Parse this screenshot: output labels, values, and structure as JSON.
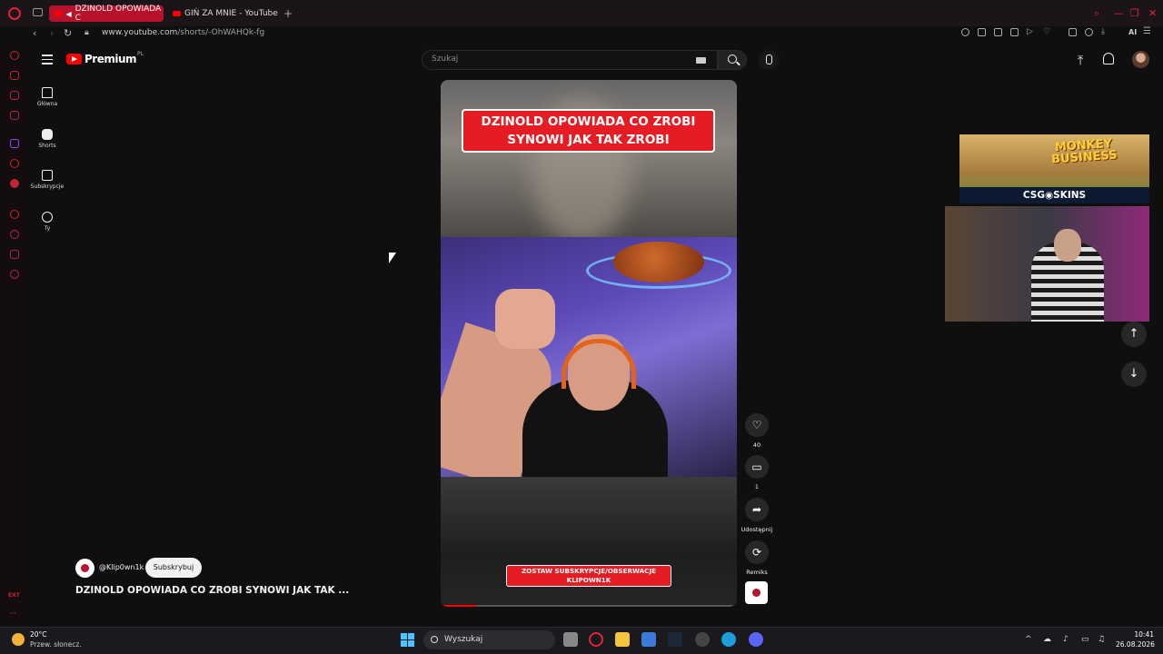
{
  "browser": {
    "tabs": [
      {
        "label": "DZINOLD OPOWIADA C",
        "active": true
      },
      {
        "label": "GIŃ ZA MNIE - YouTube",
        "active": false
      }
    ],
    "url_host": "www.youtube.com",
    "url_path": "/shorts/-OhWAHQk-fg",
    "ai_label": "AI",
    "sidebar_label": "EXT"
  },
  "youtube": {
    "logo_text": "Premium",
    "logo_country": "PL",
    "search_placeholder": "Szukaj",
    "nav": [
      {
        "label": "Główna",
        "icon": "home-icon"
      },
      {
        "label": "Shorts",
        "icon": "shorts-icon"
      },
      {
        "label": "Subskrypcje",
        "icon": "subscriptions-icon"
      },
      {
        "label": "Ty",
        "icon": "user-icon"
      }
    ]
  },
  "short": {
    "overlay_title_line1": "DZINOLD OPOWIADA CO ZROBI",
    "overlay_title_line2": "SYNOWI JAK TAK ZROBI",
    "cta_line1": "ZOSTAW SUBSKRYPCJE/OBSERWACJE",
    "cta_line2": "KLIPOWN1K",
    "progress_fraction": 0.12,
    "channel": "@Klip0wn1k",
    "subscribe_label": "Subskrybuj",
    "title": "DZINOLD OPOWIADA CO ZROBI SYNOWI JAK TAK ...",
    "actions": {
      "likes": "40",
      "comments": "1",
      "share": "Udostępnij",
      "remix": "Remiks"
    }
  },
  "overlay": {
    "ad_title": "MONKEY BUSINESS",
    "ad_brand": "CSG◉SKINS"
  },
  "taskbar": {
    "temp": "20°C",
    "condition": "Przew. słonecz.",
    "search_placeholder": "Wyszukaj",
    "time": "10:41",
    "date": "26.08.2026"
  },
  "colors": {
    "accent": "#ff0000",
    "opera": "#e0223b",
    "overlay_red": "#e51c23"
  }
}
